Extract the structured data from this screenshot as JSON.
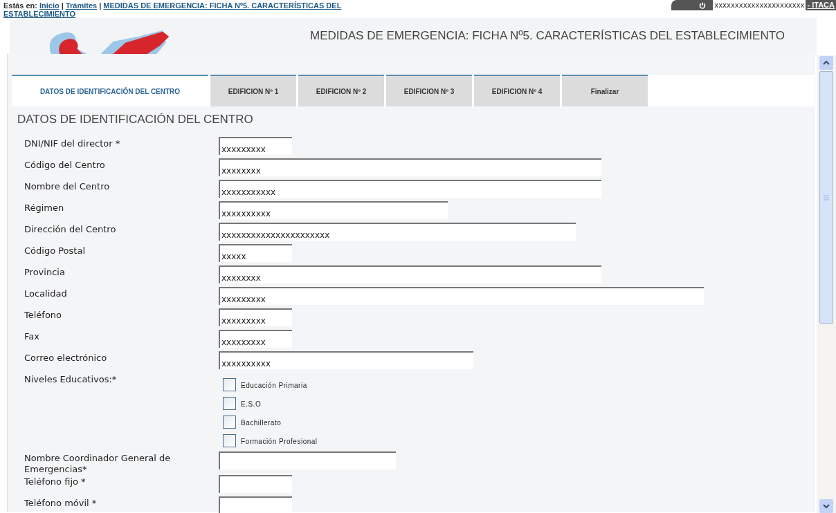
{
  "breadcrumb": {
    "prefix": "Estás en:",
    "separator": "|",
    "links": [
      "Inicio",
      "Trámites"
    ],
    "current_link_lines": [
      "MEDIDAS DE EMERGENCIA: FICHA Nº5. CARACTERÍSTICAS DEL",
      "ESTABLECIMIENTO"
    ]
  },
  "user_bar": {
    "user": "xxxxxxxxxxxxxxxxxxxxxx",
    "app": "- ITACA"
  },
  "page_title": "MEDIDAS DE EMERGENCIA: FICHA Nº5. CARACTERÍSTICAS DEL ESTABLECIMIENTO",
  "tabs": [
    {
      "label": "DATOS DE IDENTIFICACIÓN DEL CENTRO",
      "selected": true
    },
    {
      "label": "EDIFICION Nº 1",
      "selected": false
    },
    {
      "label": "EDIFICION Nº 2",
      "selected": false
    },
    {
      "label": "EDIFICION Nº 3",
      "selected": false
    },
    {
      "label": "EDIFICION Nº 4",
      "selected": false
    },
    {
      "label": "Finalizar",
      "selected": false
    }
  ],
  "section_title": "DATOS DE IDENTIFICACIÓN DEL CENTRO",
  "fields": [
    {
      "kind": "text",
      "label": "DNI/NIF del director *",
      "value": "xxxxxxxxx"
    },
    {
      "kind": "text",
      "label": "Código del Centro",
      "value": "xxxxxxxx"
    },
    {
      "kind": "text",
      "label": "Nombre del Centro",
      "value": "xxxxxxxxxxx"
    },
    {
      "kind": "text",
      "label": "Régimen",
      "value": "xxxxxxxxxx"
    },
    {
      "kind": "text",
      "label": "Dirección del Centro",
      "value": "xxxxxxxxxxxxxxxxxxxxxx"
    },
    {
      "kind": "text",
      "label": "Código Postal",
      "value": "xxxxx"
    },
    {
      "kind": "text",
      "label": "Provincia",
      "value": "xxxxxxxx"
    },
    {
      "kind": "text",
      "label": "Localidad",
      "value": "xxxxxxxxx"
    },
    {
      "kind": "text",
      "label": "Teléfono",
      "value": "xxxxxxxxx"
    },
    {
      "kind": "text",
      "label": "Fax",
      "value": "xxxxxxxxx"
    },
    {
      "kind": "text",
      "label": "Correo electrónico",
      "value": "xxxxxxxxxx"
    },
    {
      "kind": "checks",
      "label": "Niveles Educativos:*",
      "options": [
        {
          "label": "Educación Primaria",
          "checked": false
        },
        {
          "label": "E.S.O",
          "checked": false
        },
        {
          "label": "Bachillerato",
          "checked": false
        },
        {
          "label": "Formación Profesional",
          "checked": false
        }
      ]
    },
    {
      "kind": "text",
      "label": "Nombre Coordinador General de Emergencias*"
    },
    {
      "kind": "text",
      "label": "Teléfono fijo *"
    },
    {
      "kind": "text",
      "label": "Teléfono móvil *"
    }
  ]
}
